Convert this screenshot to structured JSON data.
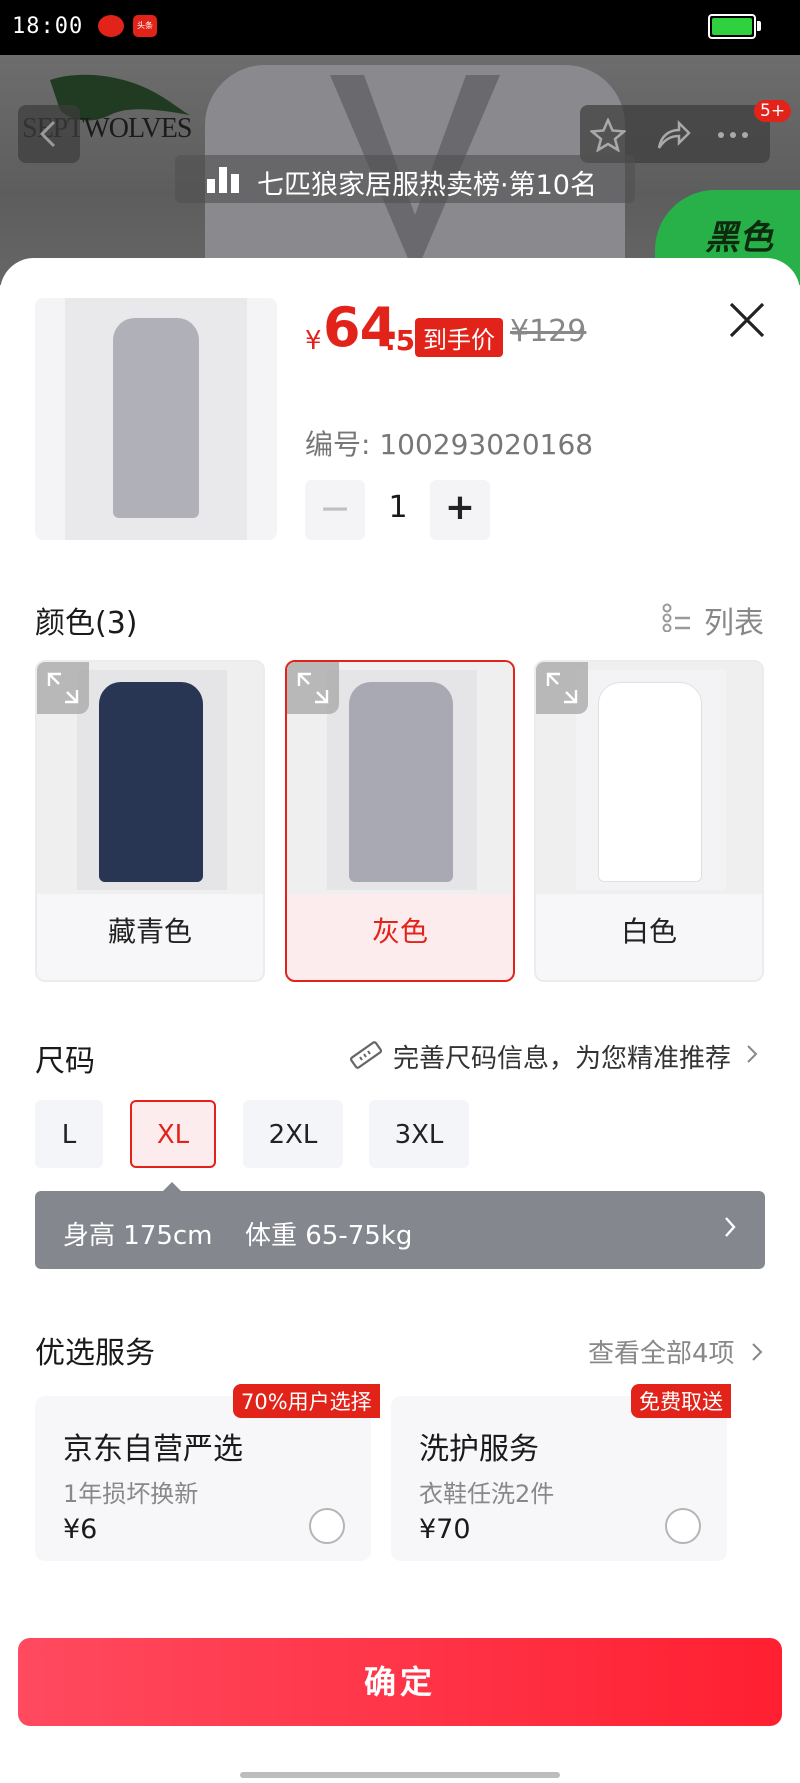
{
  "status_bar": {
    "time": "18:00",
    "app_badge": "头条",
    "battery_color": "#2fd13f"
  },
  "header": {
    "brand": "SEPTWOLVES",
    "notification_count": "5+",
    "rank_text": "七匹狼家居服热卖榜·第10名",
    "color_tag": "黑色"
  },
  "product": {
    "currency": "¥",
    "price_int": "64",
    "price_dec": ".5",
    "price_tag": "到手价",
    "original_price": "¥129",
    "sku_label": "编号: 100293020168",
    "quantity": "1",
    "minus": "−",
    "plus": "+"
  },
  "color_section": {
    "title": "颜色(3)",
    "list_label": "列表",
    "options": [
      {
        "label": "藏青色",
        "robe_color": "#283553",
        "selected": false
      },
      {
        "label": "灰色",
        "robe_color": "#a9a9b3",
        "selected": true
      },
      {
        "label": "白色",
        "robe_color": "#f2f2f2",
        "selected": false
      }
    ]
  },
  "size_section": {
    "title": "尺码",
    "hint": "完善尺码信息，为您精准推荐",
    "options": [
      {
        "label": "L",
        "selected": false
      },
      {
        "label": "XL",
        "selected": true
      },
      {
        "label": "2XL",
        "selected": false
      },
      {
        "label": "3XL",
        "selected": false
      }
    ],
    "fit_height": "身高 175cm",
    "fit_weight": "体重 65-75kg"
  },
  "services": {
    "title": "优选服务",
    "view_all": "查看全部4项",
    "items": [
      {
        "badge": "70%用户选择",
        "name": "京东自营严选",
        "desc": "1年损坏换新",
        "price": "¥6"
      },
      {
        "badge": "免费取送",
        "name": "洗护服务",
        "desc": "衣鞋任洗2件",
        "price": "¥70"
      }
    ]
  },
  "confirm_label": "确定",
  "accent_color": "#e2231a"
}
